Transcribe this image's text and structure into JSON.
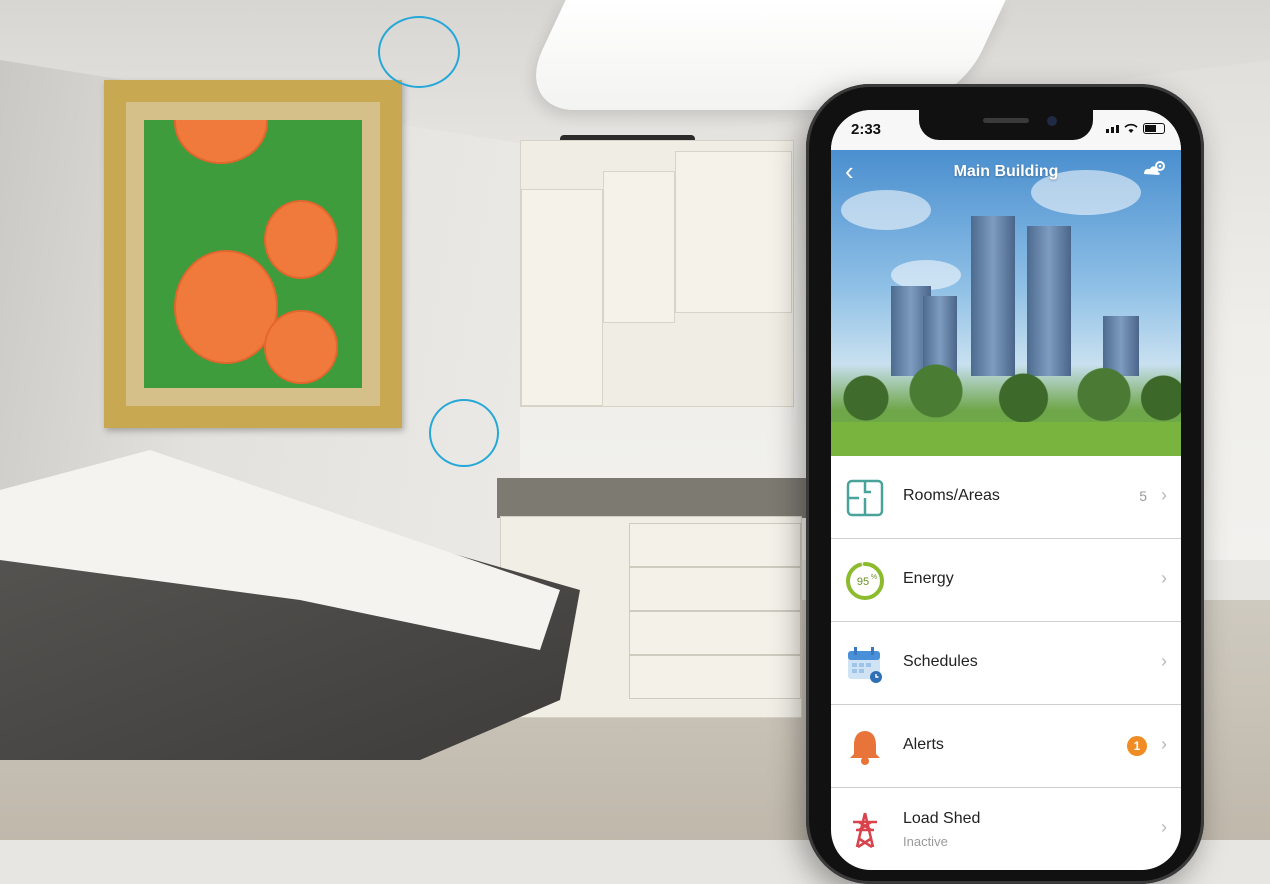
{
  "phone": {
    "status": {
      "time": "2:33"
    },
    "header": {
      "title": "Main Building"
    },
    "menu": [
      {
        "label": "Rooms/Areas",
        "count": "5",
        "icon": "floor-plan-icon"
      },
      {
        "label": "Energy",
        "energy_percent": "95",
        "energy_unit": "%",
        "icon": "energy-gauge-icon"
      },
      {
        "label": "Schedules",
        "icon": "calendar-icon"
      },
      {
        "label": "Alerts",
        "badge": "1",
        "icon": "bell-icon"
      },
      {
        "label": "Load Shed",
        "sublabel": "Inactive",
        "icon": "power-tower-icon"
      }
    ]
  },
  "colors": {
    "accent": "#25a8d8",
    "energy_ring": "#8dbb2e",
    "alert": "#e9743a",
    "badge": "#f08c23",
    "rooms_icon": "#4aa39a"
  }
}
